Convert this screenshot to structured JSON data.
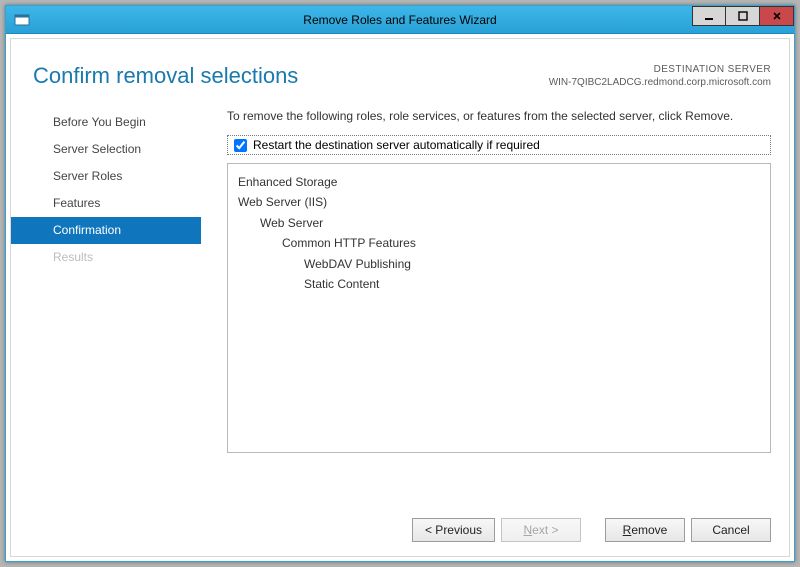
{
  "window": {
    "title": "Remove Roles and Features Wizard"
  },
  "header": {
    "page_title": "Confirm removal selections",
    "dest_label": "DESTINATION SERVER",
    "dest_name": "WIN-7QIBC2LADCG.redmond.corp.microsoft.com"
  },
  "sidebar": {
    "items": [
      {
        "label": "Before You Begin",
        "state": "normal"
      },
      {
        "label": "Server Selection",
        "state": "normal"
      },
      {
        "label": "Server Roles",
        "state": "normal"
      },
      {
        "label": "Features",
        "state": "normal"
      },
      {
        "label": "Confirmation",
        "state": "selected"
      },
      {
        "label": "Results",
        "state": "disabled"
      }
    ]
  },
  "main": {
    "instruction": "To remove the following roles, role services, or features from the selected server, click Remove.",
    "restart_label": "Restart the destination server automatically if required",
    "restart_checked": true,
    "features": [
      {
        "level": 0,
        "text": "Enhanced Storage"
      },
      {
        "level": 0,
        "text": "Web Server (IIS)"
      },
      {
        "level": 1,
        "text": "Web Server"
      },
      {
        "level": 2,
        "text": "Common HTTP Features"
      },
      {
        "level": 3,
        "text": "WebDAV Publishing"
      },
      {
        "level": 3,
        "text": "Static Content"
      }
    ]
  },
  "buttons": {
    "previous": "< Previous",
    "next_prefix": "N",
    "next_suffix": "ext >",
    "remove_prefix": "R",
    "remove_suffix": "emove",
    "cancel": "Cancel"
  }
}
